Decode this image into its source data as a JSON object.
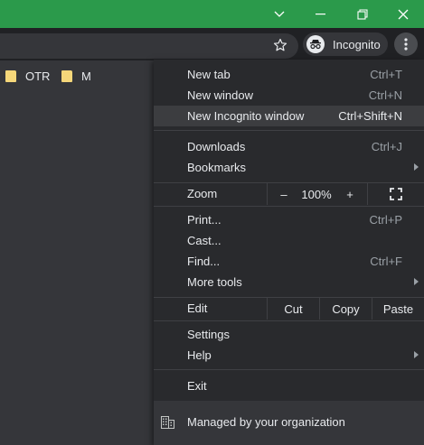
{
  "toolbar": {
    "incognito_label": "Incognito"
  },
  "bookmarks_bar": {
    "items": [
      {
        "label": "OTR"
      },
      {
        "label": "M"
      }
    ]
  },
  "menu": {
    "new_tab": {
      "label": "New tab",
      "shortcut": "Ctrl+T"
    },
    "new_window": {
      "label": "New window",
      "shortcut": "Ctrl+N"
    },
    "new_incognito": {
      "label": "New Incognito window",
      "shortcut": "Ctrl+Shift+N"
    },
    "downloads": {
      "label": "Downloads",
      "shortcut": "Ctrl+J"
    },
    "bookmarks": {
      "label": "Bookmarks"
    },
    "zoom": {
      "label": "Zoom",
      "minus": "–",
      "level": "100%",
      "plus": "+"
    },
    "print": {
      "label": "Print...",
      "shortcut": "Ctrl+P"
    },
    "cast": {
      "label": "Cast..."
    },
    "find": {
      "label": "Find...",
      "shortcut": "Ctrl+F"
    },
    "more_tools": {
      "label": "More tools"
    },
    "edit": {
      "label": "Edit",
      "cut": "Cut",
      "copy": "Copy",
      "paste": "Paste"
    },
    "settings": {
      "label": "Settings"
    },
    "help": {
      "label": "Help"
    },
    "exit": {
      "label": "Exit"
    },
    "managed": {
      "label": "Managed by your organization"
    }
  },
  "colors": {
    "titlebar": "#2b9a4b",
    "menu_bg": "#292a2d",
    "highlight": "#3c3d40"
  }
}
